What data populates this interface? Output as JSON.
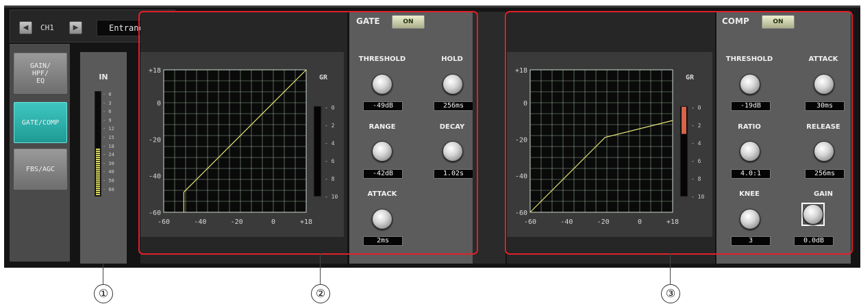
{
  "channel": {
    "label": "CH1",
    "name": "Entrance"
  },
  "tabs": [
    {
      "label": "GAIN/\nHPF/\nEQ"
    },
    {
      "label": "GATE/COMP"
    },
    {
      "label": "FBS/AGC"
    }
  ],
  "active_tab": "GATE/COMP",
  "meter": {
    "title": "IN",
    "scale": [
      "0",
      "3",
      "6",
      "9",
      "12",
      "15",
      "18",
      "24",
      "30",
      "40",
      "50",
      "60"
    ],
    "level_fraction": 0.45
  },
  "gate": {
    "title": "GATE",
    "on_label": "ON",
    "graph": {
      "gr_label": "GR",
      "y_ticks": [
        "+18",
        "0",
        "-20",
        "-40",
        "-60"
      ],
      "x_ticks": [
        "-60",
        "-40",
        "-20",
        "0",
        "+18"
      ],
      "gr_scale": [
        "0",
        "2",
        "4",
        "6",
        "8",
        "10"
      ]
    },
    "knobs": {
      "threshold": {
        "label": "THRESHOLD",
        "value": "-49dB"
      },
      "hold": {
        "label": "HOLD",
        "value": "256ms"
      },
      "range": {
        "label": "RANGE",
        "value": "-42dB"
      },
      "decay": {
        "label": "DECAY",
        "value": "1.02s"
      },
      "attack": {
        "label": "ATTACK",
        "value": "2ms"
      }
    }
  },
  "comp": {
    "title": "COMP",
    "on_label": "ON",
    "graph": {
      "gr_label": "GR",
      "y_ticks": [
        "+18",
        "0",
        "-20",
        "-40",
        "-60"
      ],
      "x_ticks": [
        "-60",
        "-40",
        "-20",
        "0",
        "+18"
      ],
      "gr_scale": [
        "0",
        "2",
        "4",
        "6",
        "8",
        "10"
      ]
    },
    "knobs": {
      "threshold": {
        "label": "THRESHOLD",
        "value": "-19dB"
      },
      "attack": {
        "label": "ATTACK",
        "value": "30ms"
      },
      "ratio": {
        "label": "RATIO",
        "value": "4.0:1"
      },
      "release": {
        "label": "RELEASE",
        "value": "256ms"
      },
      "knee": {
        "label": "KNEE",
        "value": "3"
      },
      "gain": {
        "label": "GAIN",
        "value": "0.0dB"
      }
    }
  },
  "callouts": [
    "①",
    "②",
    "③"
  ],
  "colors": {
    "accent_teal": "#2fb2ac",
    "highlight_red": "#e0202a",
    "curve_yellow": "#e6e67a",
    "grid_green": "#bfe0c0"
  }
}
